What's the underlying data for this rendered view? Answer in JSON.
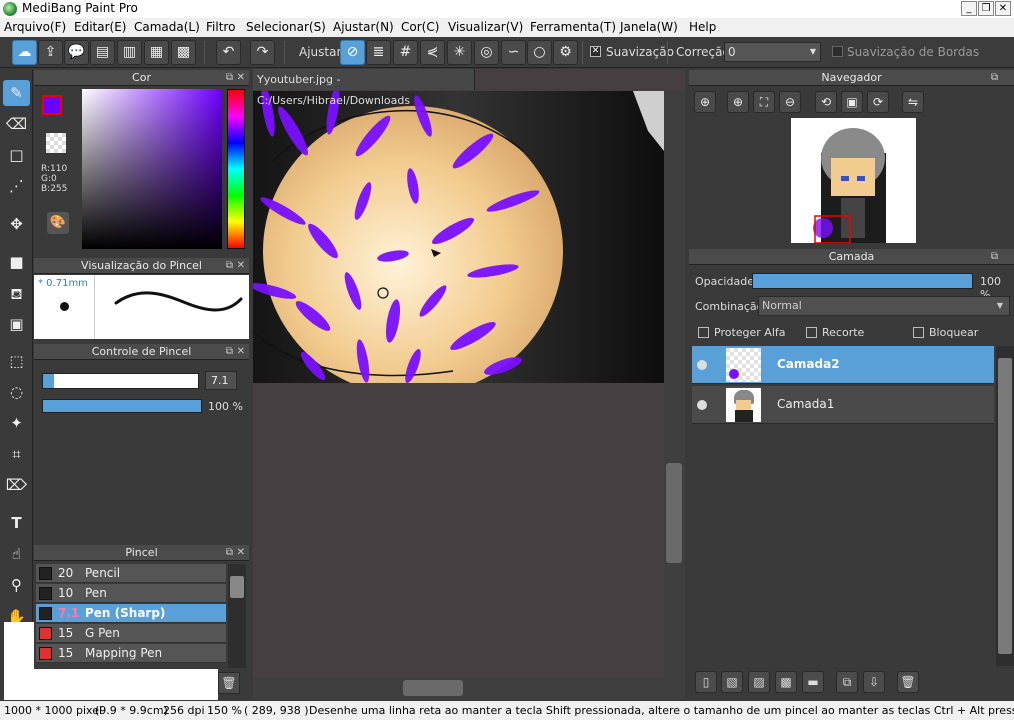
{
  "window": {
    "title": "MediBang Paint Pro",
    "min": "_",
    "max": "❐",
    "close": "✕"
  },
  "menu": [
    "Arquivo(F)",
    "Editar(E)",
    "Camada(L)",
    "Filtro",
    "Selecionar(S)",
    "Ajustar(N)",
    "Cor(C)",
    "Visualizar(V)",
    "Ferramenta(T)",
    "Janela(W)",
    "Help"
  ],
  "toolbar": {
    "ajustar_label": "Ajustar",
    "suavizacao_label": "Suavização",
    "correcao_label": "Correção",
    "correcao_value": "0",
    "suav_bordas_label": "Suavização de Bordas"
  },
  "tab": {
    "title": "Yyoutuber.jpg - C:/Users/Hibrael/Downloads"
  },
  "color_panel": {
    "title": "Cor",
    "r": "R:110",
    "g": "G:0",
    "b": "B:255",
    "fg_color": "#6e00ff"
  },
  "brush_preview": {
    "title": "Visualização do Pincel",
    "size": "* 0.71mm"
  },
  "brush_control": {
    "title": "Controle de Pincel",
    "size_value": "7.1",
    "opacity_value": "100 %",
    "size_fraction": 0.071,
    "opacity_fraction": 1.0
  },
  "brush_panel": {
    "title": "Pincel",
    "items": [
      {
        "num": "20",
        "name": "Pencil",
        "color": "#222222"
      },
      {
        "num": "10",
        "name": "Pen",
        "color": "#222222"
      },
      {
        "num": "7.1",
        "name": "Pen (Sharp)",
        "color": "#222222"
      },
      {
        "num": "15",
        "name": "G Pen",
        "color": "#e03030"
      },
      {
        "num": "15",
        "name": "Mapping Pen",
        "color": "#e03030"
      }
    ]
  },
  "navigator": {
    "title": "Navegador"
  },
  "layer_panel": {
    "title": "Camada",
    "opacity_label": "Opacidade",
    "opacity_value": "100 %",
    "opacity_fraction": 1.0,
    "blend_label": "Combinação",
    "blend_value": "Normal",
    "protect_alpha": "Proteger Alfa",
    "clip": "Recorte",
    "lock": "Bloquear",
    "layers": [
      {
        "name": "Camada2"
      },
      {
        "name": "Camada1"
      }
    ]
  },
  "status": {
    "dimensions": "1000 * 1000 pixel",
    "size_cm": "(9.9 * 9.9cm)",
    "dpi": "256 dpi",
    "zoom": "150 %",
    "coords": "( 289, 938 )",
    "hint": "Desenhe uma linha reta ao manter a tecla Shift pressionada, altere o tamanho de um pincel ao manter as teclas Ctrl + Alt pressionadas e arrastando"
  }
}
